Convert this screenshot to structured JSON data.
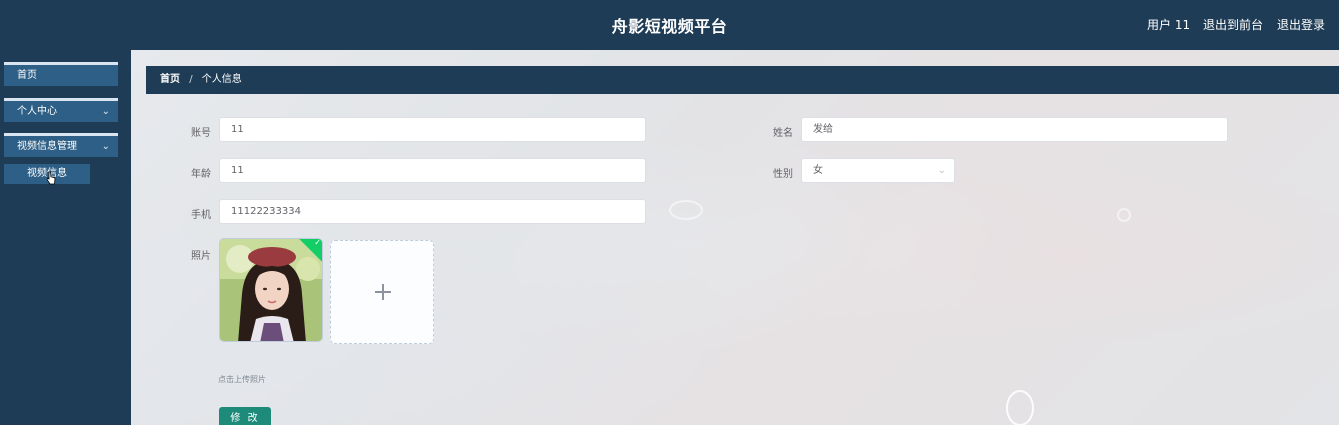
{
  "header": {
    "app_title": "舟影短视频平台",
    "user_label": "用户 11",
    "back_to_front": "退出到前台",
    "logout": "退出登录"
  },
  "sidebar": {
    "home": "首页",
    "personal_center": "个人中心",
    "video_management": "视频信息管理",
    "video_info": "视频信息"
  },
  "breadcrumb": {
    "home": "首页",
    "separator": "/",
    "current": "个人信息"
  },
  "form": {
    "account": {
      "label": "账号",
      "value": "11"
    },
    "name": {
      "label": "姓名",
      "value": "发给"
    },
    "age": {
      "label": "年龄",
      "value": "11"
    },
    "gender": {
      "label": "性别",
      "value": "女"
    },
    "phone": {
      "label": "手机",
      "value": "11122233334"
    },
    "photo": {
      "label": "照片"
    },
    "upload_hint": "点击上传照片",
    "submit_label": "修 改"
  },
  "colors": {
    "header_bg": "#1e3c55",
    "menu_item_bg": "#2e5f86",
    "submit_bg": "#1e8a7a",
    "upload_check": "#13ce66"
  }
}
